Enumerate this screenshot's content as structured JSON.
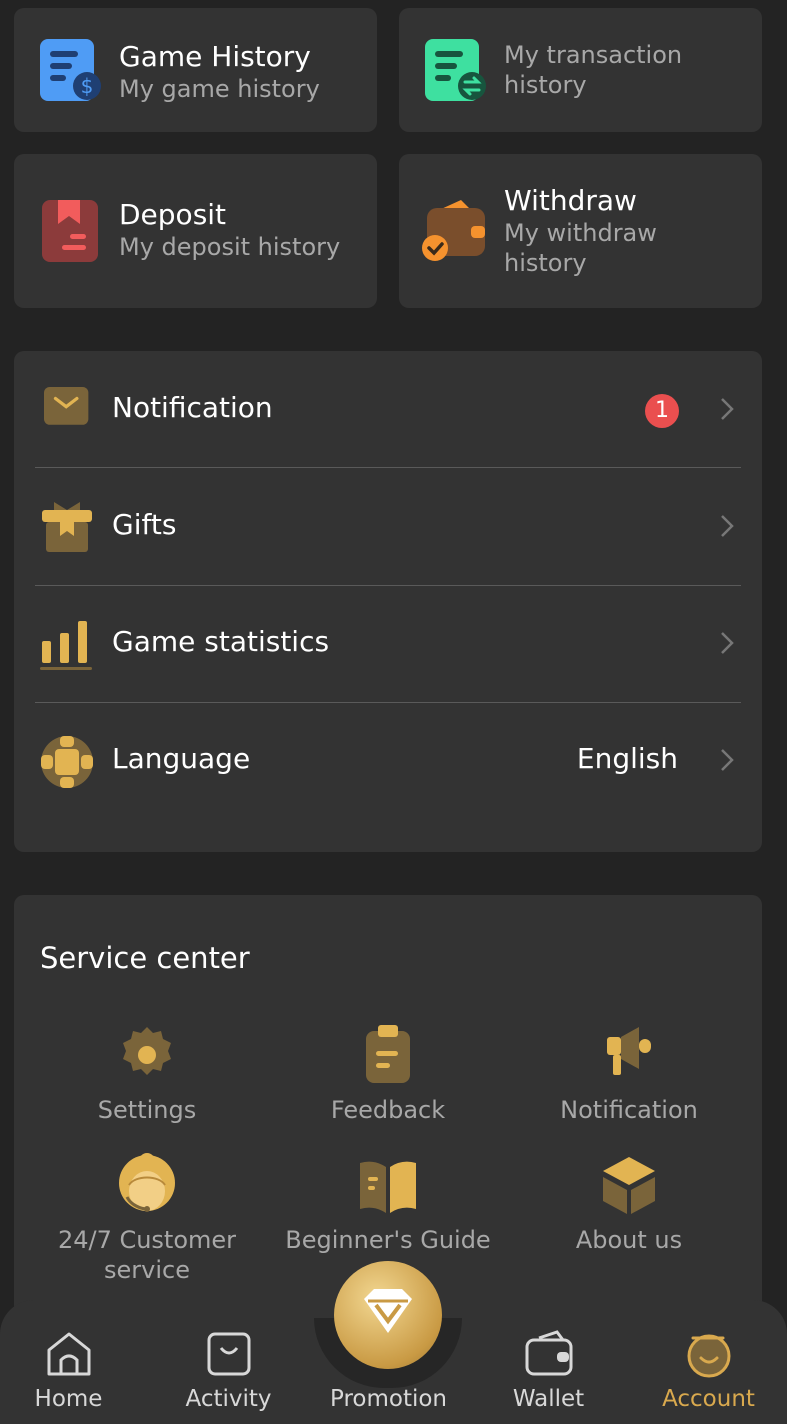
{
  "tiles": [
    {
      "title": "Game History",
      "subtitle": "My game history",
      "icon": "game-history-icon"
    },
    {
      "title": "",
      "subtitle": "My transaction history",
      "icon": "transaction-icon"
    },
    {
      "title": "Deposit",
      "subtitle": "My deposit history",
      "icon": "deposit-icon"
    },
    {
      "title": "Withdraw",
      "subtitle": "My withdraw history",
      "icon": "wallet-withdraw-icon"
    }
  ],
  "menu": {
    "notification": {
      "label": "Notification",
      "badge": "1"
    },
    "gifts": {
      "label": "Gifts"
    },
    "stats": {
      "label": "Game statistics"
    },
    "language": {
      "label": "Language",
      "value": "English"
    }
  },
  "service": {
    "title": "Service center",
    "items": [
      {
        "label": "Settings",
        "icon": "gear-icon"
      },
      {
        "label": "Feedback",
        "icon": "clipboard-icon"
      },
      {
        "label": "Notification",
        "icon": "megaphone-icon"
      },
      {
        "label": "24/7 Customer service",
        "icon": "customer-service-icon"
      },
      {
        "label": "Beginner's Guide",
        "icon": "book-icon"
      },
      {
        "label": "About us",
        "icon": "box-icon"
      }
    ]
  },
  "tabs": [
    {
      "label": "Home",
      "icon": "home-icon"
    },
    {
      "label": "Activity",
      "icon": "activity-icon"
    },
    {
      "label": "Promotion",
      "icon": "diamond-icon"
    },
    {
      "label": "Wallet",
      "icon": "wallet-icon"
    },
    {
      "label": "Account",
      "icon": "account-icon",
      "active": true
    }
  ],
  "colors": {
    "accent": "#d9a94e",
    "card": "#333333",
    "background": "#232323",
    "badge": "#ea4f4f"
  }
}
